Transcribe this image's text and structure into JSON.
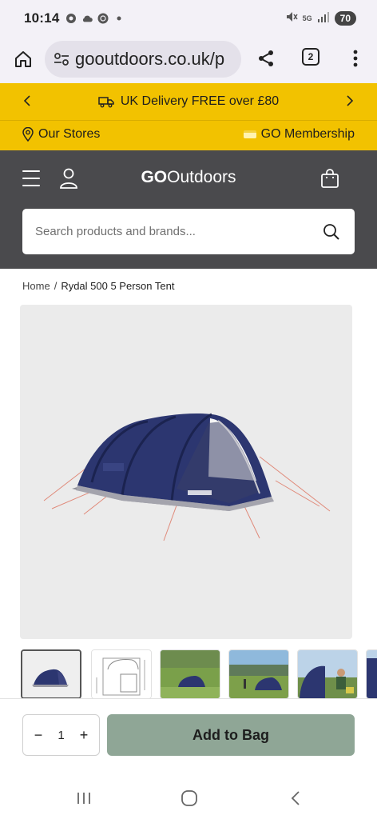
{
  "status_bar": {
    "time": "10:14",
    "network": "5G",
    "battery": "70",
    "icons": [
      "chrome-icon",
      "cloud-icon",
      "app-icon",
      "dot-icon",
      "mute-icon",
      "signal-icon"
    ]
  },
  "browser": {
    "url": "gooutdoors.co.uk/p",
    "tab_count": "2",
    "icons": [
      "home-icon",
      "site-settings-icon",
      "share-icon",
      "tabs-icon",
      "more-icon"
    ]
  },
  "promo": {
    "delivery_text": "UK Delivery FREE over £80",
    "prev_icon": "chevron-left-icon",
    "next_icon": "chevron-right-icon",
    "stores_label": "Our Stores",
    "membership_label": "GO Membership",
    "bar_color": "#f2c200"
  },
  "header": {
    "logo_bold": "GO",
    "logo_rest": "Outdoors",
    "search_placeholder": "Search products and brands...",
    "bg_color": "#4a4a4d"
  },
  "breadcrumb": {
    "home": "Home",
    "separator": "/",
    "current": "Rydal 500 5 Person Tent"
  },
  "product": {
    "image_alt": "Rydal 500 5 Person Tent",
    "thumbnails": [
      "thumb-tent-main",
      "thumb-tent-diagram",
      "thumb-tent-field",
      "thumb-tent-lake",
      "thumb-tent-people",
      "thumb-tent-partial"
    ]
  },
  "purchase": {
    "quantity": "1",
    "minus": "−",
    "plus": "+",
    "add_to_bag_label": "Add to Bag",
    "button_color": "#8fa696"
  },
  "nav": {
    "icons": [
      "recent-apps-icon",
      "home-nav-icon",
      "back-icon"
    ]
  }
}
